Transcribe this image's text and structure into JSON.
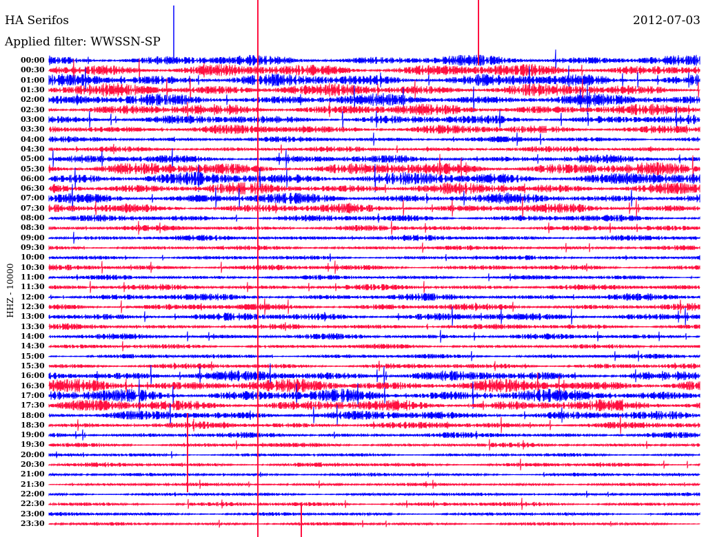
{
  "header": {
    "station": "HA Serifos",
    "date": "2012-07-03",
    "filter": "Applied filter: WWSSN-SP"
  },
  "chart_data": {
    "type": "line",
    "title": "HA Serifos",
    "subtitle": "Applied filter: WWSSN-SP",
    "ylabel": "HHZ - 10000",
    "xlabel": "",
    "row_labels": [
      "00:00",
      "00:30",
      "01:00",
      "01:30",
      "02:00",
      "02:30",
      "03:00",
      "03:30",
      "04:00",
      "04:30",
      "05:00",
      "05:30",
      "06:00",
      "06:30",
      "07:00",
      "07:30",
      "08:00",
      "08:30",
      "09:00",
      "09:30",
      "10:00",
      "10:30",
      "11:00",
      "11:30",
      "12:00",
      "12:30",
      "13:00",
      "13:30",
      "14:00",
      "14:30",
      "15:00",
      "15:30",
      "16:00",
      "16:30",
      "17:00",
      "17:30",
      "18:00",
      "18:30",
      "19:00",
      "19:30",
      "20:00",
      "20:30",
      "21:00",
      "21:30",
      "22:00",
      "22:30",
      "23:00",
      "23:30"
    ],
    "relative_amplitude": [
      9,
      11,
      11,
      11,
      10,
      10,
      8,
      8,
      5,
      5,
      7,
      11,
      11,
      10,
      9,
      8,
      6,
      5,
      5,
      4,
      4,
      5,
      4,
      5,
      6,
      6,
      7,
      5,
      5,
      4,
      4,
      5,
      9,
      11,
      11,
      10,
      8,
      6,
      5,
      4,
      3,
      4,
      3,
      3,
      3,
      4,
      3,
      3
    ],
    "series_colors": [
      "#0000ff",
      "#ff1040"
    ]
  }
}
